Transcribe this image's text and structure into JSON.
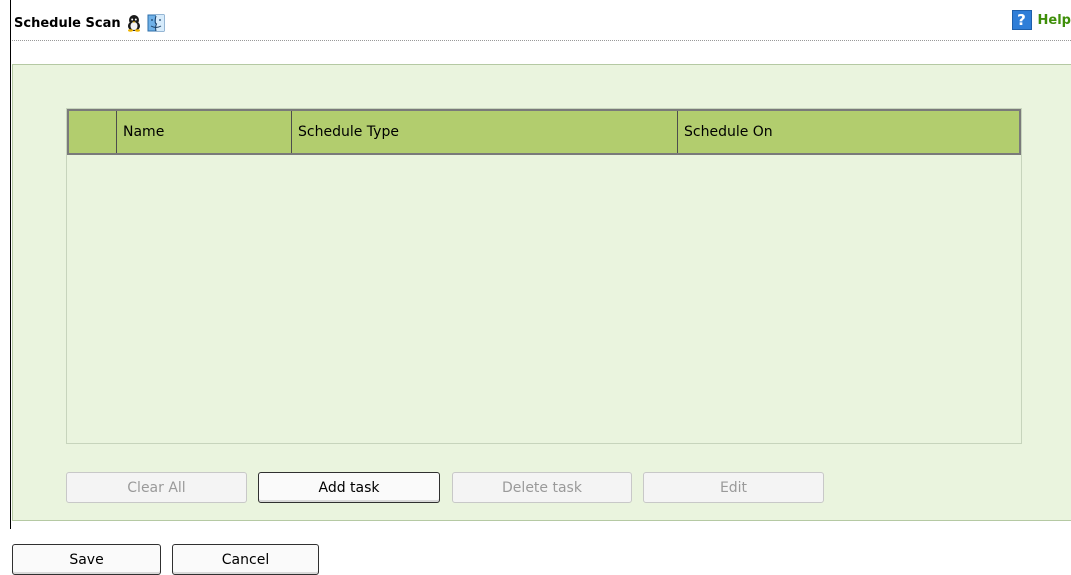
{
  "header": {
    "title": "Schedule Scan",
    "title_icons": [
      "linux-penguin-icon",
      "mac-finder-icon"
    ],
    "help_label": "Help",
    "help_icon": "question-mark-icon"
  },
  "table": {
    "columns": [
      "",
      "Name",
      "Schedule Type",
      "Schedule On"
    ],
    "rows": []
  },
  "actions": {
    "clear_all": "Clear All",
    "add_task": "Add task",
    "delete_task": "Delete task",
    "edit": "Edit"
  },
  "footer": {
    "save": "Save",
    "cancel": "Cancel"
  },
  "colors": {
    "panel_bg": "#eaf4de",
    "header_bg": "#b2cd6e",
    "help_text": "#3f8f0a"
  }
}
